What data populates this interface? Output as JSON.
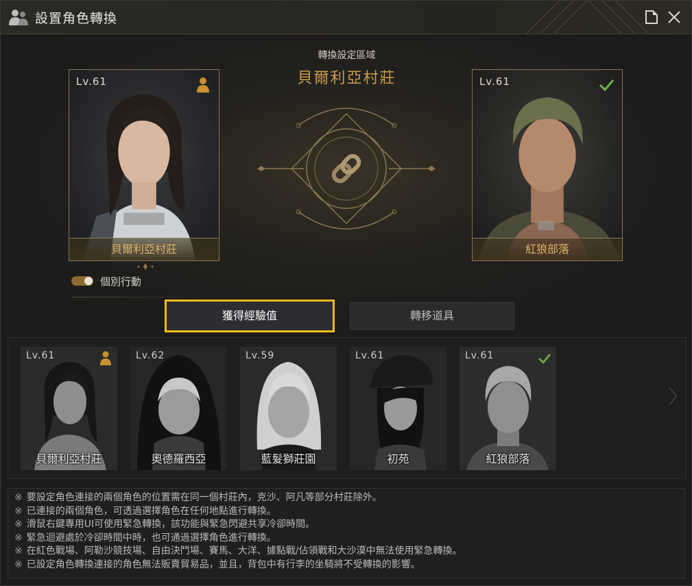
{
  "window": {
    "title": "設置角色轉換"
  },
  "zone": {
    "label": "轉換設定區域",
    "name": "貝爾利亞村莊"
  },
  "left_card": {
    "level": "Lv.61",
    "name": "貝爾利亞村莊",
    "badge": "person-icon"
  },
  "right_card": {
    "level": "Lv.61",
    "name": "紅狼部落",
    "badge": "check-icon"
  },
  "toggle": {
    "label": "個別行動",
    "on": true
  },
  "tabs": [
    {
      "label": "獲得經驗值",
      "active": true
    },
    {
      "label": "轉移道具",
      "active": false
    }
  ],
  "roster": [
    {
      "level": "Lv.61",
      "name": "貝爾利亞村莊",
      "badge": "person-icon"
    },
    {
      "level": "Lv.62",
      "name": "奧德羅西亞",
      "badge": ""
    },
    {
      "level": "Lv.59",
      "name": "藍髮獅莊園",
      "badge": ""
    },
    {
      "level": "Lv.61",
      "name": "初苑",
      "badge": ""
    },
    {
      "level": "Lv.61",
      "name": "紅狼部落",
      "badge": "check-icon"
    }
  ],
  "notes": {
    "mark": "※",
    "lines": [
      "要設定角色連接的兩個角色的位置需在同一個村莊內，克沙、阿凡等部分村莊除外。",
      "已連接的兩個角色，可透過選擇角色在任何地點進行轉換。",
      "滑鼠右鍵專用UI可使用緊急轉換，該功能與緊急閃避共享冷卻時間。",
      "緊急迴避處於冷卻時間中時，也可通過選擇角色進行轉換。",
      "在紅色戰場、阿勒沙競技場、自由決鬥場、賽馬、大洋、據點戰/佔領戰和大沙漠中無法使用緊急轉換。",
      "已設定角色轉換連接的角色無法販賣貿易品，並且，背包中有行李的坐騎將不受轉換的影響。"
    ]
  },
  "colors": {
    "accent_gold": "#c99a4a",
    "active_tab_border": "#f2bc1c",
    "check_green": "#6fb04a"
  }
}
